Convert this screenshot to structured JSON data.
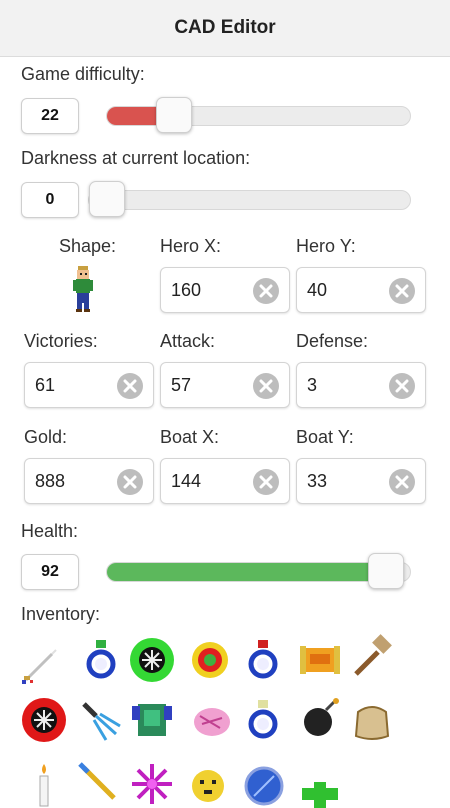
{
  "app": {
    "title": "CAD Editor"
  },
  "difficulty": {
    "label": "Game difficulty:",
    "value": "22",
    "level_fraction": 0.22,
    "fill_color": "#d9534f"
  },
  "darkness": {
    "label": "Darkness at current location:",
    "value": "0",
    "level_fraction": 0.0
  },
  "stats": {
    "shape_label": "Shape:",
    "hero_x_label": "Hero X:",
    "hero_x": "160",
    "hero_y_label": "Hero Y:",
    "hero_y": "40",
    "victories_label": "Victories:",
    "victories": "61",
    "attack_label": "Attack:",
    "attack": "57",
    "defense_label": "Defense:",
    "defense": "3",
    "gold_label": "Gold:",
    "gold": "888",
    "boat_x_label": "Boat X:",
    "boat_x": "144",
    "boat_y_label": "Boat Y:",
    "boat_y": "33"
  },
  "health": {
    "label": "Health:",
    "value": "92",
    "level_fraction": 0.92,
    "fill_color": "#5cb85c"
  },
  "inventory": {
    "label": "Inventory:",
    "items": [
      "sword-icon",
      "ring-icon",
      "green-orb-icon",
      "red-gem-icon",
      "ring-red-icon",
      "scroll-icon",
      "hammer-icon",
      "red-orb-icon",
      "claw-icon",
      "armor-icon",
      "pink-creature-icon",
      "ring-blue-icon",
      "bomb-icon",
      "bag-icon",
      "candle-icon",
      "golden-sword-icon",
      "star-flower-icon",
      "face-icon",
      "blue-orb-icon",
      "plus-icon"
    ]
  }
}
